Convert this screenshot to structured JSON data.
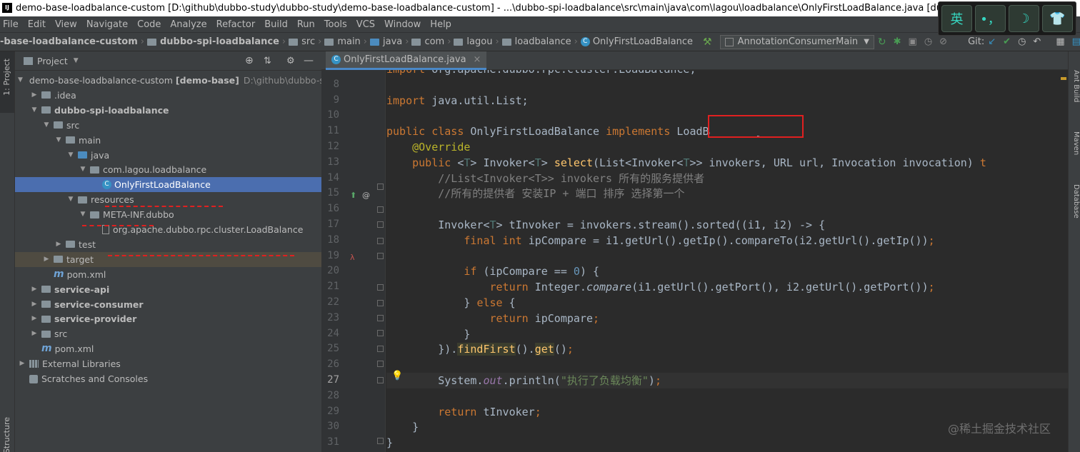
{
  "window": {
    "title": "demo-base-loadbalance-custom [D:\\github\\dubbo-study\\dubbo-study\\demo-base-loadbalance-custom] - ...\\dubbo-spi-loadbalance\\src\\main\\java\\com\\lagou\\loadbalance\\OnlyFirstLoadBalance.java [dubbo-spi-loadbalance]"
  },
  "ime": {
    "keys": [
      "英",
      "•，",
      "☽",
      "👕"
    ]
  },
  "menu": [
    "File",
    "Edit",
    "View",
    "Navigate",
    "Code",
    "Analyze",
    "Refactor",
    "Build",
    "Run",
    "Tools",
    "VCS",
    "Window",
    "Help"
  ],
  "breadcrumbs": [
    "-base-loadbalance-custom",
    "dubbo-spi-loadbalance",
    "src",
    "main",
    "java",
    "com",
    "lagou",
    "loadbalance",
    "OnlyFirstLoadBalance"
  ],
  "run_config": "AnnotationConsumerMain",
  "git_label": "Git:",
  "project": {
    "header": "Project",
    "tree": [
      {
        "label": "demo-base-loadbalance-custom",
        "extra": "[demo-base]",
        "path": "D:\\github\\dubbo-stu",
        "bold": false,
        "depth": 0,
        "arrow": "▼",
        "icon": "folder"
      },
      {
        "label": ".idea",
        "depth": 1,
        "arrow": "▶",
        "icon": "folder"
      },
      {
        "label": "dubbo-spi-loadbalance",
        "depth": 1,
        "arrow": "▼",
        "icon": "folder",
        "bold": true
      },
      {
        "label": "src",
        "depth": 2,
        "arrow": "▼",
        "icon": "folder"
      },
      {
        "label": "main",
        "depth": 3,
        "arrow": "▼",
        "icon": "folder"
      },
      {
        "label": "java",
        "depth": 4,
        "arrow": "▼",
        "icon": "src"
      },
      {
        "label": "com.lagou.loadbalance",
        "depth": 5,
        "arrow": "▼",
        "icon": "folder"
      },
      {
        "label": "OnlyFirstLoadBalance",
        "depth": 6,
        "arrow": "",
        "icon": "class",
        "selected": true
      },
      {
        "label": "resources",
        "depth": 4,
        "arrow": "▼",
        "icon": "folder"
      },
      {
        "label": "META-INF.dubbo",
        "depth": 5,
        "arrow": "▼",
        "icon": "folder"
      },
      {
        "label": "org.apache.dubbo.rpc.cluster.LoadBalance",
        "depth": 6,
        "arrow": "",
        "icon": "file"
      },
      {
        "label": "test",
        "depth": 3,
        "arrow": "▶",
        "icon": "folder"
      },
      {
        "label": "target",
        "depth": 2,
        "arrow": "▶",
        "icon": "folder",
        "highlight": true
      },
      {
        "label": "pom.xml",
        "depth": 2,
        "arrow": "",
        "icon": "maven"
      },
      {
        "label": "service-api",
        "depth": 1,
        "arrow": "▶",
        "icon": "folder",
        "bold": true
      },
      {
        "label": "service-consumer",
        "depth": 1,
        "arrow": "▶",
        "icon": "folder",
        "bold": true
      },
      {
        "label": "service-provider",
        "depth": 1,
        "arrow": "▶",
        "icon": "folder",
        "bold": true
      },
      {
        "label": "src",
        "depth": 1,
        "arrow": "▶",
        "icon": "folder"
      },
      {
        "label": "pom.xml",
        "depth": 1,
        "arrow": "",
        "icon": "maven"
      },
      {
        "label": "External Libraries",
        "depth": 0,
        "arrow": "▶",
        "icon": "lib"
      },
      {
        "label": "Scratches and Consoles",
        "depth": 0,
        "arrow": "",
        "icon": "scratch"
      }
    ]
  },
  "left_tools": [
    "1: Project",
    "Structure"
  ],
  "right_tools": [
    "Ant Build",
    "Maven",
    "Database"
  ],
  "editor": {
    "tab": "OnlyFirstLoadBalance.java",
    "current_line": 27,
    "lines": [
      {
        "n": "",
        "html": "import org.apache.dubbo.rpc.cluster.LoadBalance;"
      },
      {
        "n": "8",
        "t": []
      },
      {
        "n": "9",
        "t": [
          [
            "kw",
            "import "
          ],
          [
            "",
            "java.util.List;"
          ]
        ]
      },
      {
        "n": "10",
        "t": []
      },
      {
        "n": "11",
        "t": [
          [
            "kw",
            "public class "
          ],
          [
            "",
            "OnlyFirstLoadBalance "
          ],
          [
            "kw",
            "implements "
          ],
          [
            "",
            "LoadBalance {"
          ]
        ]
      },
      {
        "n": "12",
        "t": [
          [
            "an",
            "    @Override"
          ]
        ]
      },
      {
        "n": "13",
        "t": [
          [
            "kw",
            "    public "
          ],
          [
            "",
            "<"
          ],
          [
            "tp",
            "T"
          ],
          [
            "",
            "> Invoker<"
          ],
          [
            "tp",
            "T"
          ],
          [
            "",
            "> "
          ],
          [
            "fn",
            "select"
          ],
          [
            "",
            "(List<Invoker<"
          ],
          [
            "tp",
            "T"
          ],
          [
            "",
            ">> invokers, URL url, Invocation invocation) "
          ],
          [
            "kw",
            "t"
          ]
        ]
      },
      {
        "n": "14",
        "t": [
          [
            "cm",
            "        //List<Invoker<T>> invokers 所有的服务提供者"
          ]
        ]
      },
      {
        "n": "15",
        "t": [
          [
            "cm",
            "        //所有的提供者 安装IP + 端口 排序 选择第一个"
          ]
        ]
      },
      {
        "n": "16",
        "t": []
      },
      {
        "n": "17",
        "t": [
          [
            "",
            "        Invoker<"
          ],
          [
            "tp",
            "T"
          ],
          [
            "",
            "> tInvoker = invokers.stream().sorted((i1, i2) -> {"
          ]
        ]
      },
      {
        "n": "18",
        "t": [
          [
            "kw",
            "            final int "
          ],
          [
            "",
            "ipCompare = i1.getUrl().getIp().compareTo(i2.getUrl().getIp())"
          ],
          [
            "kw",
            ";"
          ]
        ]
      },
      {
        "n": "19",
        "t": []
      },
      {
        "n": "20",
        "t": [
          [
            "kw",
            "            if "
          ],
          [
            "",
            "(ipCompare == "
          ],
          [
            "nm",
            "0"
          ],
          [
            "",
            ") {"
          ]
        ]
      },
      {
        "n": "21",
        "t": [
          [
            "kw",
            "                return "
          ],
          [
            "",
            "Integer."
          ],
          [
            "it",
            "compare"
          ],
          [
            "",
            "(i1.getUrl().getPort(), i2.getUrl().getPort())"
          ],
          [
            "kw",
            ";"
          ]
        ]
      },
      {
        "n": "22",
        "t": [
          [
            "",
            "            } "
          ],
          [
            "kw",
            "else "
          ],
          [
            "",
            "{"
          ]
        ]
      },
      {
        "n": "23",
        "t": [
          [
            "kw",
            "                return "
          ],
          [
            "",
            "ipCompare"
          ],
          [
            "kw",
            ";"
          ]
        ]
      },
      {
        "n": "24",
        "t": [
          [
            "",
            "            }"
          ]
        ]
      },
      {
        "n": "25",
        "t": [
          [
            "",
            "        })."
          ],
          [
            "fnhl",
            "findFirst"
          ],
          [
            "",
            "()."
          ],
          [
            "fnhl",
            "get"
          ],
          [
            "",
            "()"
          ],
          [
            "kw",
            ";"
          ]
        ]
      },
      {
        "n": "26",
        "t": []
      },
      {
        "n": "27",
        "t": [
          [
            "",
            "        System."
          ],
          [
            "sf",
            "out"
          ],
          [
            "",
            ".println("
          ],
          [
            "st",
            "\"执行了负载均衡\""
          ],
          [
            "",
            ")"
          ],
          [
            "kw",
            ";"
          ]
        ]
      },
      {
        "n": "28",
        "t": []
      },
      {
        "n": "29",
        "t": [
          [
            "kw",
            "        return "
          ],
          [
            "",
            "tInvoker"
          ],
          [
            "kw",
            ";"
          ]
        ]
      },
      {
        "n": "30",
        "t": [
          [
            "",
            "    }"
          ]
        ]
      },
      {
        "n": "31",
        "t": [
          [
            "",
            "}"
          ]
        ]
      }
    ]
  },
  "watermark": "@稀土掘金技术社区"
}
